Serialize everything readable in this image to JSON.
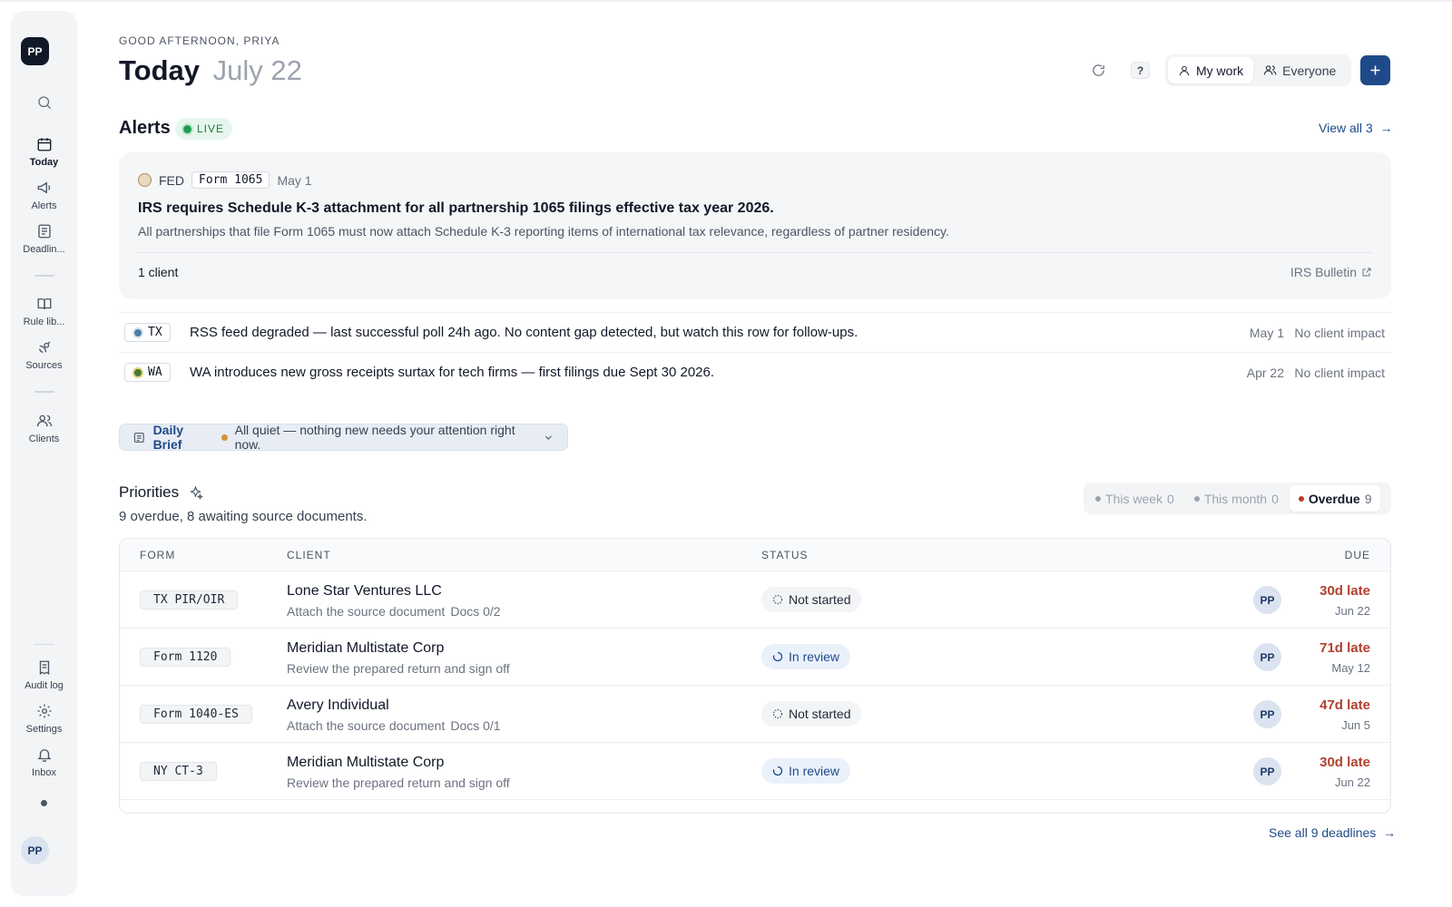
{
  "sidebar": {
    "logo": "PP",
    "items": [
      {
        "label": "Today",
        "icon": "calendar-icon"
      },
      {
        "label": "Alerts",
        "icon": "megaphone-icon"
      },
      {
        "label": "Deadlin...",
        "icon": "document-icon"
      },
      {
        "label": "Rule lib...",
        "icon": "book-icon"
      },
      {
        "label": "Sources",
        "icon": "satellite-icon"
      },
      {
        "label": "Clients",
        "icon": "users-icon"
      },
      {
        "label": "Audit log",
        "icon": "receipt-icon"
      },
      {
        "label": "Settings",
        "icon": "gear-icon"
      },
      {
        "label": "Inbox",
        "icon": "bell-icon"
      }
    ],
    "user_avatar": "PP"
  },
  "header": {
    "greeting": "GOOD AFTERNOON, PRIYA",
    "title": "Today",
    "date": "July 22",
    "help_label": "?",
    "scope": {
      "my_work": "My work",
      "everyone": "Everyone",
      "selected": "My work"
    }
  },
  "alerts": {
    "title": "Alerts",
    "live": "LIVE",
    "view_all": "View all 3",
    "featured": {
      "jurisdiction": "FED",
      "form": "Form 1065",
      "date": "May 1",
      "headline": "IRS requires Schedule K-3 attachment for all partnership 1065 filings effective tax year 2026.",
      "body": "All partnerships that file Form 1065 must now attach Schedule K-3 reporting items of international tax relevance, regardless of partner residency.",
      "clients": "1 client",
      "source_link": "IRS Bulletin"
    },
    "rows": [
      {
        "jurisdiction": "TX",
        "text": "RSS feed degraded — last successful poll 24h ago. No content gap detected, but watch this row for follow-ups.",
        "date": "May 1",
        "impact": "No client impact"
      },
      {
        "jurisdiction": "WA",
        "text": "WA introduces new gross receipts surtax for tech firms — first filings due Sept 30 2026.",
        "date": "Apr 22",
        "impact": "No client impact"
      }
    ]
  },
  "daily_brief": {
    "label": "Daily Brief",
    "message": "All quiet — nothing new needs your attention right now."
  },
  "priorities": {
    "title": "Priorities",
    "summary": "9 overdue, 8 awaiting source documents.",
    "filters": [
      {
        "label": "This week",
        "count": "0"
      },
      {
        "label": "This month",
        "count": "0"
      },
      {
        "label": "Overdue",
        "count": "9"
      }
    ],
    "selected_filter": "Overdue",
    "columns": {
      "form": "FORM",
      "client": "CLIENT",
      "status": "STATUS",
      "due": "DUE"
    },
    "rows": [
      {
        "form": "TX PIR/OIR",
        "client": "Lone Star Ventures LLC",
        "task": "Attach the source document",
        "docs": "Docs 0/2",
        "status": "Not started",
        "assignee": "PP",
        "late": "30d late",
        "due_date": "Jun 22"
      },
      {
        "form": "Form 1120",
        "client": "Meridian Multistate Corp",
        "task": "Review the prepared return and sign off",
        "docs": "",
        "status": "In review",
        "assignee": "PP",
        "late": "71d late",
        "due_date": "May 12"
      },
      {
        "form": "Form 1040-ES",
        "client": "Avery Individual",
        "task": "Attach the source document",
        "docs": "Docs 0/1",
        "status": "Not started",
        "assignee": "PP",
        "late": "47d late",
        "due_date": "Jun 5"
      },
      {
        "form": "NY CT-3",
        "client": "Meridian Multistate Corp",
        "task": "Review the prepared return and sign off",
        "docs": "",
        "status": "In review",
        "assignee": "PP",
        "late": "30d late",
        "due_date": "Jun 22"
      }
    ],
    "see_all": "See all 9 deadlines"
  },
  "colors": {
    "accent": "#1f4a8a",
    "late": "#b2402e",
    "live": "#1f9d55",
    "brief_dot": "#d4903a"
  }
}
